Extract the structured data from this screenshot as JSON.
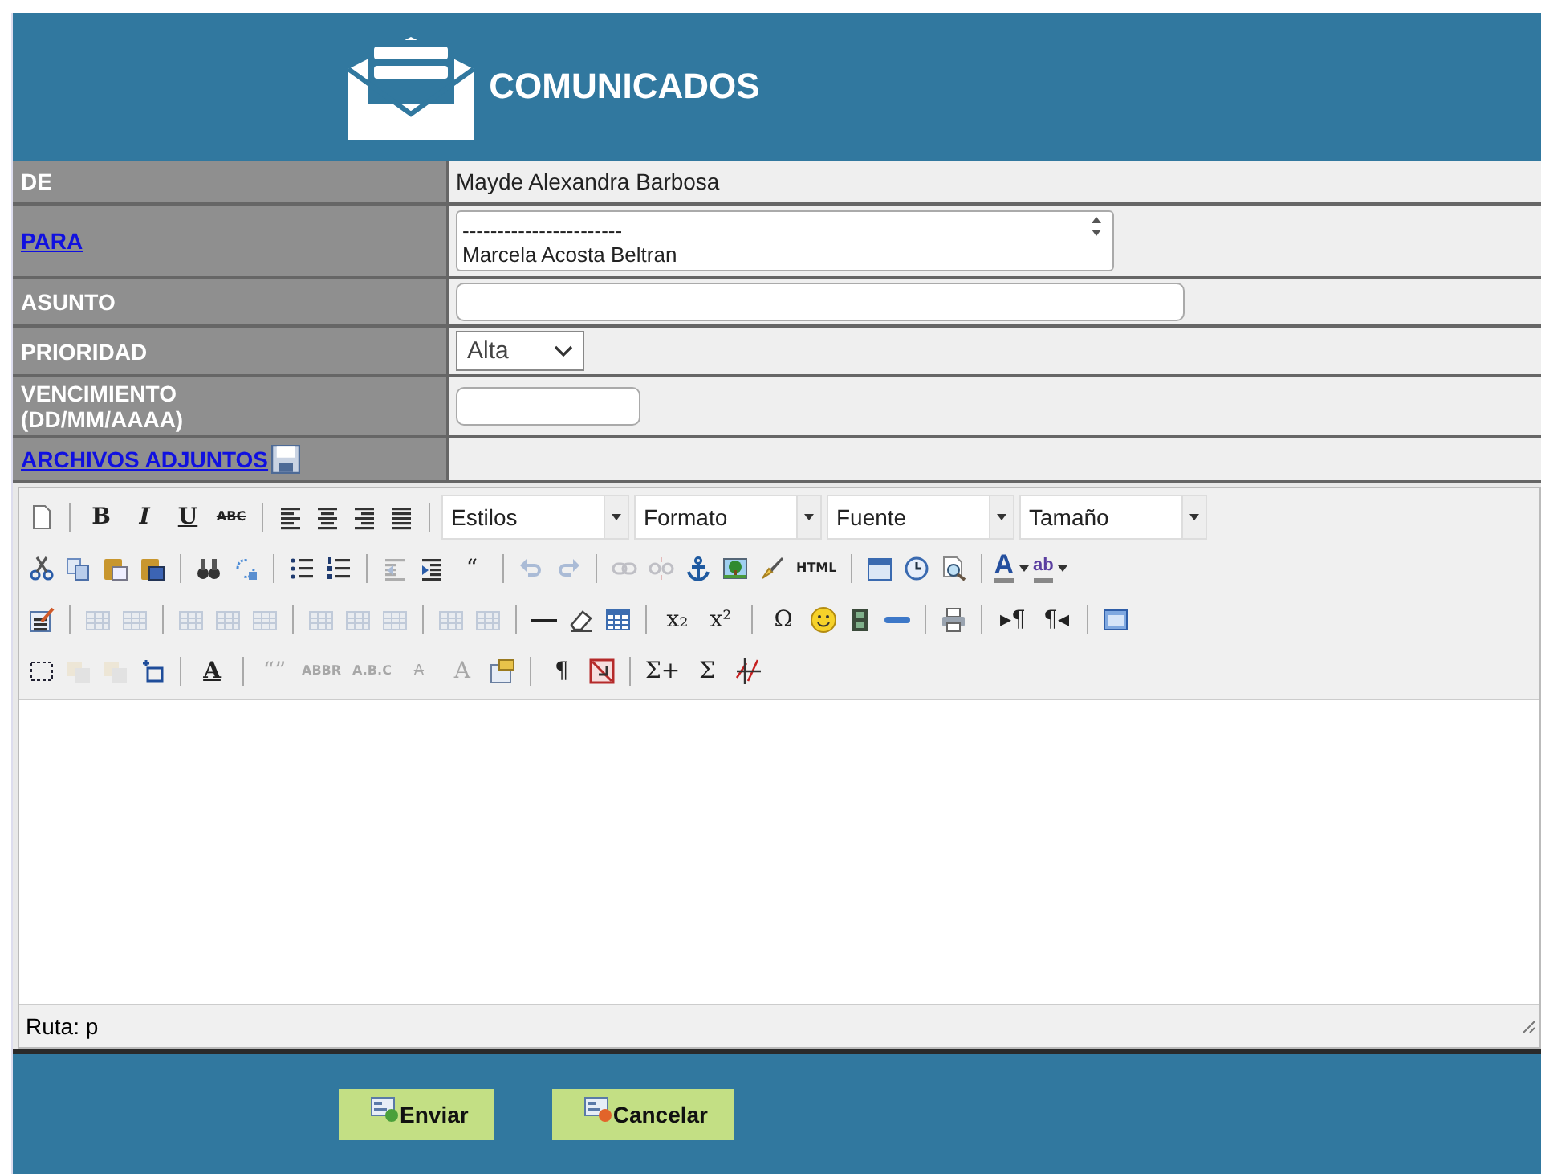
{
  "header": {
    "title": "COMUNICADOS"
  },
  "fields": [
    {
      "kind": "text",
      "label": "DE",
      "link": false,
      "value": "Mayde Alexandra Barbosa"
    },
    {
      "kind": "listbox",
      "label": "PARA",
      "link": true,
      "options": [
        "-----------------------",
        "Marcela Acosta Beltran"
      ]
    },
    {
      "kind": "input",
      "label": "ASUNTO",
      "link": false
    },
    {
      "kind": "select",
      "label": "PRIORIDAD",
      "link": false,
      "value": "Alta"
    },
    {
      "kind": "date",
      "label": "VENCIMIENTO",
      "sublabel": "(DD/MM/AAAA)",
      "link": false
    },
    {
      "kind": "attach",
      "label": "ARCHIVOS ADJUNTOS",
      "link": true
    }
  ],
  "editor": {
    "toolbar": [
      [
        {
          "kind": "doc",
          "disabled": false
        },
        {
          "kind": "sep"
        },
        {
          "kind": "bold",
          "text": "B",
          "disabled": false
        },
        {
          "kind": "italic",
          "text": "I",
          "disabled": false
        },
        {
          "kind": "underline",
          "text": "U",
          "disabled": false
        },
        {
          "kind": "strike",
          "text": "ABC",
          "disabled": false
        },
        {
          "kind": "sep"
        },
        {
          "kind": "align-left",
          "disabled": false
        },
        {
          "kind": "align-center",
          "disabled": false
        },
        {
          "kind": "align-right",
          "disabled": false
        },
        {
          "kind": "justify",
          "disabled": false
        },
        {
          "kind": "sep"
        },
        {
          "kind": "dropdown",
          "label": "Estilos"
        },
        {
          "kind": "dropdown",
          "label": "Formato"
        },
        {
          "kind": "dropdown",
          "label": "Fuente"
        },
        {
          "kind": "dropdown",
          "label": "Tamaño"
        }
      ],
      [
        {
          "kind": "cut",
          "disabled": false
        },
        {
          "kind": "copy",
          "disabled": false
        },
        {
          "kind": "paste",
          "disabled": false
        },
        {
          "kind": "paste-word",
          "disabled": false
        },
        {
          "kind": "sep"
        },
        {
          "kind": "find",
          "disabled": false
        },
        {
          "kind": "replace",
          "disabled": false
        },
        {
          "kind": "sep"
        },
        {
          "kind": "bullets",
          "disabled": false
        },
        {
          "kind": "numbers",
          "disabled": false
        },
        {
          "kind": "sep"
        },
        {
          "kind": "outdent",
          "disabled": true
        },
        {
          "kind": "indent",
          "disabled": false
        },
        {
          "kind": "glyph",
          "text": "“",
          "disabled": false
        },
        {
          "kind": "sep"
        },
        {
          "kind": "undo",
          "disabled": true
        },
        {
          "kind": "redo",
          "disabled": true
        },
        {
          "kind": "sep"
        },
        {
          "kind": "link",
          "disabled": true
        },
        {
          "kind": "unlink",
          "disabled": true
        },
        {
          "kind": "anchor",
          "disabled": false
        },
        {
          "kind": "image",
          "disabled": false
        },
        {
          "kind": "brush",
          "disabled": false
        },
        {
          "kind": "glyph",
          "text": "HTML",
          "disabled": false
        },
        {
          "kind": "sep"
        },
        {
          "kind": "calendar",
          "disabled": false
        },
        {
          "kind": "clock",
          "disabled": false
        },
        {
          "kind": "preview",
          "disabled": false
        },
        {
          "kind": "sep"
        },
        {
          "kind": "color-menu",
          "text": "A",
          "disabled": false
        },
        {
          "kind": "highlight-menu",
          "text": "ab",
          "disabled": false
        }
      ],
      [
        {
          "kind": "form",
          "disabled": false
        },
        {
          "kind": "sep"
        },
        {
          "kind": "grid",
          "disabled": true
        },
        {
          "kind": "grid",
          "disabled": true
        },
        {
          "kind": "sep"
        },
        {
          "kind": "grid",
          "disabled": true
        },
        {
          "kind": "grid",
          "disabled": true
        },
        {
          "kind": "grid",
          "disabled": true
        },
        {
          "kind": "sep"
        },
        {
          "kind": "grid",
          "disabled": true
        },
        {
          "kind": "grid",
          "disabled": true
        },
        {
          "kind": "grid",
          "disabled": true
        },
        {
          "kind": "sep"
        },
        {
          "kind": "grid",
          "disabled": true
        },
        {
          "kind": "grid",
          "disabled": true
        },
        {
          "kind": "sep"
        },
        {
          "kind": "rule",
          "disabled": false
        },
        {
          "kind": "eraser",
          "disabled": false
        },
        {
          "kind": "table",
          "disabled": false
        },
        {
          "kind": "sep"
        },
        {
          "kind": "glyph",
          "text": "x₂",
          "disabled": false
        },
        {
          "kind": "glyph",
          "text": "x²",
          "disabled": false
        },
        {
          "kind": "sep"
        },
        {
          "kind": "glyph",
          "text": "Ω",
          "disabled": false
        },
        {
          "kind": "smiley",
          "disabled": false
        },
        {
          "kind": "film",
          "disabled": false
        },
        {
          "kind": "bar",
          "disabled": false
        },
        {
          "kind": "sep"
        },
        {
          "kind": "print",
          "disabled": false
        },
        {
          "kind": "sep"
        },
        {
          "kind": "glyph",
          "text": "▸¶",
          "disabled": false
        },
        {
          "kind": "glyph",
          "text": "¶◂",
          "disabled": false
        },
        {
          "kind": "sep"
        },
        {
          "kind": "window",
          "disabled": false
        }
      ],
      [
        {
          "kind": "select-all",
          "disabled": false
        },
        {
          "kind": "layer",
          "disabled": true
        },
        {
          "kind": "layer",
          "disabled": true
        },
        {
          "kind": "crop",
          "disabled": false
        },
        {
          "kind": "sep"
        },
        {
          "kind": "underline",
          "text": "A",
          "disabled": false
        },
        {
          "kind": "sep"
        },
        {
          "kind": "glyph",
          "text": "“”",
          "disabled": true
        },
        {
          "kind": "glyph",
          "text": "ABBR",
          "disabled": true
        },
        {
          "kind": "glyph",
          "text": "A.B.C",
          "disabled": true
        },
        {
          "kind": "strike",
          "text": "A",
          "disabled": true
        },
        {
          "kind": "glyph",
          "text": "A",
          "disabled": true
        },
        {
          "kind": "template",
          "disabled": false
        },
        {
          "kind": "sep"
        },
        {
          "kind": "glyph",
          "text": "¶",
          "disabled": false
        },
        {
          "kind": "nobreak",
          "disabled": false
        },
        {
          "kind": "sep"
        },
        {
          "kind": "glyph",
          "text": "Σ+",
          "disabled": false
        },
        {
          "kind": "glyph",
          "text": "Σ",
          "disabled": false
        },
        {
          "kind": "formula",
          "disabled": false
        }
      ]
    ],
    "status": "Ruta: p"
  },
  "buttons": [
    {
      "kind": "send",
      "label": "Enviar"
    },
    {
      "kind": "cancel",
      "label": "Cancelar"
    }
  ]
}
